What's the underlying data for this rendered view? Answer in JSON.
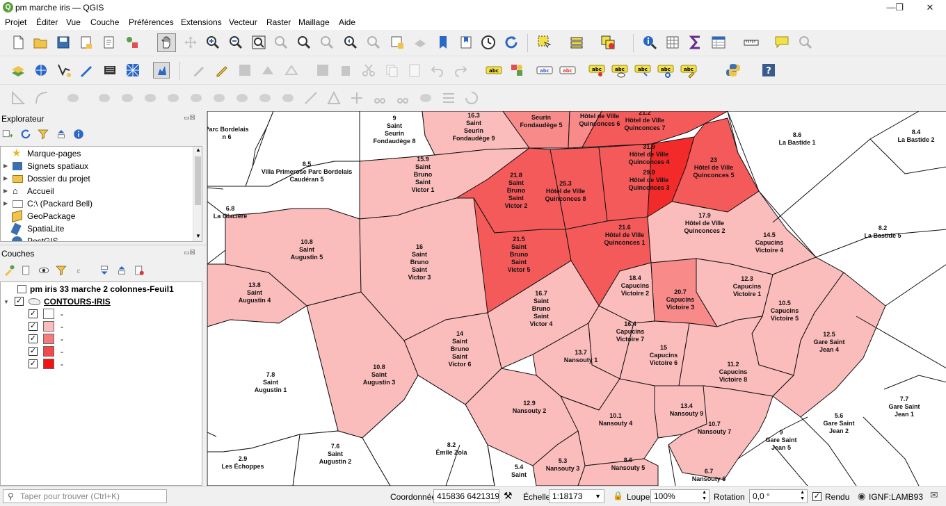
{
  "window": {
    "title": "pm marche iris — QGIS",
    "app_icon": "Q"
  },
  "menu": [
    "Projet",
    "Éditer",
    "Vue",
    "Couche",
    "Préférences",
    "Extensions",
    "Vecteur",
    "Raster",
    "Maillage",
    "Aide"
  ],
  "browser": {
    "title": "Explorateur",
    "items": [
      "Marque-pages",
      "Signets spatiaux",
      "Dossier du projet",
      "Accueil",
      "C:\\ (Packard Bell)",
      "GeoPackage",
      "SpatiaLite",
      "PostGIS"
    ]
  },
  "layers": {
    "title": "Couches",
    "items": [
      {
        "name": "pm iris 33 marche 2 colonnes-Feuil1"
      },
      {
        "name": "CONTOURS-IRIS"
      }
    ],
    "legend": [
      {
        "label": "-",
        "color": "#ffffff"
      },
      {
        "label": "-",
        "color": "#fbbcbc"
      },
      {
        "label": "-",
        "color": "#f77a7a"
      },
      {
        "label": "-",
        "color": "#f54848"
      },
      {
        "label": "-",
        "color": "#f21414"
      }
    ]
  },
  "map": {
    "colors": {
      "c0": "#ffffff",
      "c1": "#fbbcbc",
      "c2": "#f88a8a",
      "c3": "#f55a5a",
      "c4": "#f22a2a"
    },
    "labels": [
      {
        "value": "9",
        "name": "Saint Seurin Fondaudège 8"
      },
      {
        "value": "16.3",
        "name": "Saint Seurin Fondaudège 9"
      },
      {
        "value": "",
        "name": "Seurin Fondaudège 5"
      },
      {
        "value": "",
        "name": "Hôtel de Ville Quinconces 6"
      },
      {
        "value": "21.2",
        "name": "Hôtel de Ville Quinconces 7"
      },
      {
        "value": "8.6",
        "name": "La Bastide 1"
      },
      {
        "value": "8.4",
        "name": "La Bastide 2"
      },
      {
        "value": "",
        "name": "Parc Bordelais n 6"
      },
      {
        "value": "8.5",
        "name": "Villa Primerose Parc Bordelais Caudéran 5"
      },
      {
        "value": "15.9",
        "name": "Saint Bruno Saint Victor 1"
      },
      {
        "value": "21.8",
        "name": "Saint Bruno Saint Victor 2"
      },
      {
        "value": "25.3",
        "name": "Hôtel de Ville Quinconces 8"
      },
      {
        "value": "31.9",
        "name": "Hôtel de Ville Quinconces 4"
      },
      {
        "value": "29.9",
        "name": "Hôtel de Ville Quinconces 3"
      },
      {
        "value": "23",
        "name": "Hôtel de Ville Quinconces 5"
      },
      {
        "value": "6.8",
        "name": "La Glacière"
      },
      {
        "value": "17.9",
        "name": "Hôtel de Ville Quinconces 2"
      },
      {
        "value": "8.2",
        "name": "La Bastide 5"
      },
      {
        "value": "10.8",
        "name": "Saint Augustin 5"
      },
      {
        "value": "16",
        "name": "Saint Bruno Saint Victor 3"
      },
      {
        "value": "21.5",
        "name": "Saint Bruno Saint Victor 5"
      },
      {
        "value": "21.6",
        "name": "Hôtel de Ville Quinconces 1"
      },
      {
        "value": "14.5",
        "name": "Capucins Victoire 4"
      },
      {
        "value": "13.8",
        "name": "Saint Augustin 4"
      },
      {
        "value": "18.4",
        "name": "Capucins Victoire 2"
      },
      {
        "value": "20.7",
        "name": "Capucins Victoire 3"
      },
      {
        "value": "12.3",
        "name": "Capucins Victoire 1"
      },
      {
        "value": "16.7",
        "name": "Saint Bruno Saint Victor 4"
      },
      {
        "value": "10.5",
        "name": "Capucins Victoire 5"
      },
      {
        "value": "14",
        "name": "Saint Bruno Saint Victor 6"
      },
      {
        "value": "16.4",
        "name": "Capucins Victoire 7"
      },
      {
        "value": "12.5",
        "name": "Gare Saint Jean 4"
      },
      {
        "value": "13.7",
        "name": "Nansouty 1"
      },
      {
        "value": "15",
        "name": "Capucins Victoire 6"
      },
      {
        "value": "10.8",
        "name": "Saint Augustin 3"
      },
      {
        "value": "7.8",
        "name": "Saint Augustin 1"
      },
      {
        "value": "11.2",
        "name": "Capucins Victoire 8"
      },
      {
        "value": "12.9",
        "name": "Nansouty 2"
      },
      {
        "value": "7.7",
        "name": "Gare Saint Jean 1"
      },
      {
        "value": "13.4",
        "name": "Nansouty 9"
      },
      {
        "value": "5.6",
        "name": "Gare Saint Jean 2"
      },
      {
        "value": "10.1",
        "name": "Nansouty 4"
      },
      {
        "value": "10.7",
        "name": "Nansouty 7"
      },
      {
        "value": "9",
        "name": "Gare Saint Jean 5"
      },
      {
        "value": "2.9",
        "name": "Les Échoppes"
      },
      {
        "value": "7.6",
        "name": "Saint Augustin 2"
      },
      {
        "value": "8.2",
        "name": "Émile Zola"
      },
      {
        "value": "5.4",
        "name": "Saint"
      },
      {
        "value": "5.3",
        "name": "Nansouty 3"
      },
      {
        "value": "8.6",
        "name": "Nansouty 5"
      },
      {
        "value": "6.7",
        "name": "Nansouty 6"
      }
    ]
  },
  "status": {
    "search_placeholder": "Taper pour trouver (Ctrl+K)",
    "coord_label": "Coordonnée",
    "coord_value": "415836 6421319",
    "scale_label": "Échelle",
    "scale_value": "1:18173",
    "zoom_label": "Loupe",
    "zoom_value": "100%",
    "rotation_label": "Rotation",
    "rotation_value": "0,0 °",
    "render_label": "Rendu",
    "crs": "IGNF:LAMB93"
  }
}
